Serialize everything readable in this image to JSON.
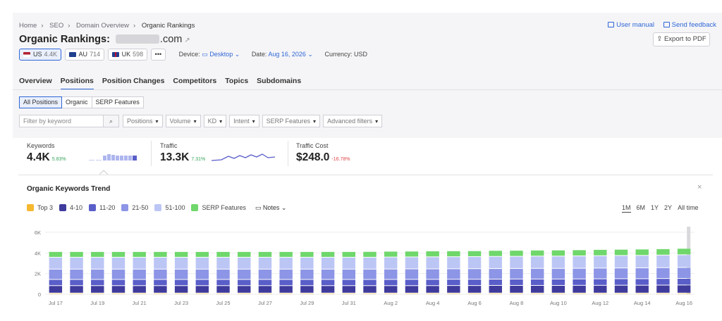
{
  "breadcrumb": [
    "Home",
    "SEO",
    "Domain Overview",
    "Organic Rankings"
  ],
  "header": {
    "user_manual": "User manual",
    "send_feedback": "Send feedback",
    "title_prefix": "Organic Rankings:",
    "domain_tld": ".com",
    "export": "Export to PDF"
  },
  "databases": [
    {
      "flag": "US",
      "count": "4.4K",
      "active": true
    },
    {
      "flag": "AU",
      "count": "714",
      "active": false
    },
    {
      "flag": "UK",
      "count": "598",
      "active": false
    }
  ],
  "more": "•••",
  "device": {
    "label": "Device:",
    "value": "Desktop"
  },
  "date": {
    "label": "Date:",
    "value": "Aug 16, 2026"
  },
  "currency": {
    "label": "Currency: USD"
  },
  "tabs": [
    "Overview",
    "Positions",
    "Position Changes",
    "Competitors",
    "Topics",
    "Subdomains"
  ],
  "segments": [
    "All Positions",
    "Organic",
    "SERP Features"
  ],
  "filters": {
    "keyword_placeholder": "Filter by keyword",
    "dropdowns": [
      "Positions",
      "Volume",
      "KD",
      "Intent",
      "SERP Features",
      "Advanced filters"
    ]
  },
  "metrics": {
    "keywords": {
      "label": "Keywords",
      "value": "4.4K",
      "change": "5.83%",
      "change_color": "#3aa55d"
    },
    "traffic": {
      "label": "Traffic",
      "value": "13.3K",
      "change": "7.31%",
      "change_color": "#3aa55d"
    },
    "traffic_cost": {
      "label": "Traffic Cost",
      "value": "$248.0",
      "change": "-16.78%",
      "change_color": "#e0484b"
    }
  },
  "trend": {
    "title": "Organic Keywords Trend",
    "legend": [
      {
        "name": "Top 3",
        "color": "#f5b82e"
      },
      {
        "name": "4-10",
        "color": "#3f3b9c"
      },
      {
        "name": "11-20",
        "color": "#5a5ec9"
      },
      {
        "name": "21-50",
        "color": "#8c95e6"
      },
      {
        "name": "51-100",
        "color": "#bcc6f5"
      },
      {
        "name": "SERP Features",
        "color": "#6fd76b"
      }
    ],
    "notes": "Notes",
    "periods": [
      "1M",
      "6M",
      "1Y",
      "2Y",
      "All time"
    ],
    "active_period": "1M"
  },
  "chart_data": {
    "type": "bar",
    "stacked": true,
    "y_ticks": [
      "0",
      "2K",
      "4K",
      "6K"
    ],
    "ylim": [
      0,
      6000
    ],
    "x_tick_labels": [
      "Jul 17",
      "Jul 19",
      "Jul 21",
      "Jul 23",
      "Jul 25",
      "Jul 27",
      "Jul 29",
      "Jul 31",
      "Aug 2",
      "Aug 4",
      "Aug 6",
      "Aug 8",
      "Aug 10",
      "Aug 12",
      "Aug 14",
      "Aug 16"
    ],
    "categories": [
      "Jul 17",
      "Jul 18",
      "Jul 19",
      "Jul 20",
      "Jul 21",
      "Jul 22",
      "Jul 23",
      "Jul 24",
      "Jul 25",
      "Jul 26",
      "Jul 27",
      "Jul 28",
      "Jul 29",
      "Jul 30",
      "Jul 31",
      "Aug 1",
      "Aug 2",
      "Aug 3",
      "Aug 4",
      "Aug 5",
      "Aug 6",
      "Aug 7",
      "Aug 8",
      "Aug 9",
      "Aug 10",
      "Aug 11",
      "Aug 12",
      "Aug 13",
      "Aug 14",
      "Aug 15",
      "Aug 16"
    ],
    "series": [
      {
        "name": "Top 3",
        "color": "#f5b82e",
        "values": [
          80,
          80,
          80,
          80,
          80,
          80,
          80,
          80,
          80,
          80,
          80,
          80,
          80,
          80,
          80,
          80,
          80,
          80,
          80,
          80,
          80,
          80,
          80,
          80,
          80,
          80,
          80,
          80,
          80,
          80,
          80
        ]
      },
      {
        "name": "4-10",
        "color": "#3f3b9c",
        "values": [
          720,
          720,
          720,
          720,
          720,
          720,
          720,
          720,
          720,
          720,
          720,
          720,
          720,
          720,
          720,
          720,
          720,
          720,
          720,
          730,
          730,
          740,
          740,
          740,
          740,
          750,
          750,
          760,
          760,
          770,
          780
        ]
      },
      {
        "name": "11-20",
        "color": "#5a5ec9",
        "values": [
          600,
          600,
          600,
          600,
          600,
          600,
          600,
          600,
          600,
          600,
          600,
          600,
          600,
          600,
          600,
          600,
          600,
          610,
          610,
          610,
          610,
          610,
          620,
          620,
          620,
          620,
          630,
          630,
          630,
          640,
          640
        ]
      },
      {
        "name": "21-50",
        "color": "#8c95e6",
        "values": [
          1000,
          1000,
          1000,
          1000,
          1000,
          1000,
          1000,
          1000,
          1000,
          1000,
          1000,
          1000,
          1000,
          1000,
          1000,
          1000,
          1010,
          1010,
          1010,
          1010,
          1020,
          1020,
          1020,
          1030,
          1030,
          1030,
          1040,
          1040,
          1050,
          1050,
          1060
        ]
      },
      {
        "name": "51-100",
        "color": "#bcc6f5",
        "values": [
          1150,
          1150,
          1150,
          1150,
          1150,
          1150,
          1150,
          1150,
          1150,
          1150,
          1150,
          1150,
          1150,
          1150,
          1150,
          1150,
          1160,
          1160,
          1170,
          1170,
          1170,
          1180,
          1180,
          1190,
          1190,
          1200,
          1200,
          1210,
          1210,
          1220,
          1230
        ]
      },
      {
        "name": "SERP Features",
        "color": "#6fd76b",
        "values": [
          550,
          550,
          550,
          550,
          550,
          550,
          550,
          550,
          550,
          550,
          550,
          550,
          550,
          550,
          550,
          560,
          560,
          560,
          570,
          570,
          570,
          580,
          580,
          580,
          590,
          590,
          600,
          600,
          610,
          610,
          620
        ]
      }
    ]
  }
}
